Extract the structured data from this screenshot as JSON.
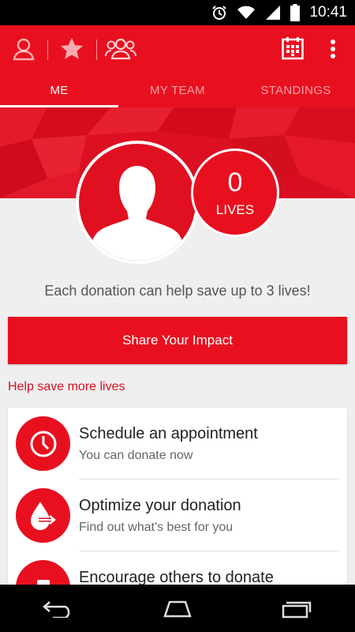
{
  "status_bar": {
    "time": "10:41",
    "icons": [
      "alarm-icon",
      "wifi-icon",
      "signal-icon",
      "battery-icon"
    ]
  },
  "app_bar": {
    "icons": [
      "profile-icon",
      "star-icon",
      "team-icon",
      "calendar-icon",
      "overflow-menu-icon"
    ],
    "tabs": [
      {
        "label": "ME",
        "active": true
      },
      {
        "label": "MY TEAM",
        "active": false
      },
      {
        "label": "STANDINGS",
        "active": false
      }
    ]
  },
  "profile": {
    "lives_count": "0",
    "lives_label": "LIVES"
  },
  "tagline": "Each donation can help save up to 3 lives!",
  "share_button": "Share Your Impact",
  "section_title": "Help save more lives",
  "actions": [
    {
      "title": "Schedule an appointment",
      "subtitle": "You can donate now",
      "icon": "clock-icon"
    },
    {
      "title": "Optimize your donation",
      "subtitle": "Find out what's best for you",
      "icon": "blood-drop-icon"
    },
    {
      "title": "Encourage others to donate",
      "subtitle": "",
      "icon": "share-icon"
    }
  ],
  "nav_bar": {
    "icons": [
      "back-icon",
      "home-icon",
      "recents-icon"
    ]
  },
  "colors": {
    "primary": "#e8101f",
    "section_title": "#d61020",
    "background": "#efefef"
  }
}
